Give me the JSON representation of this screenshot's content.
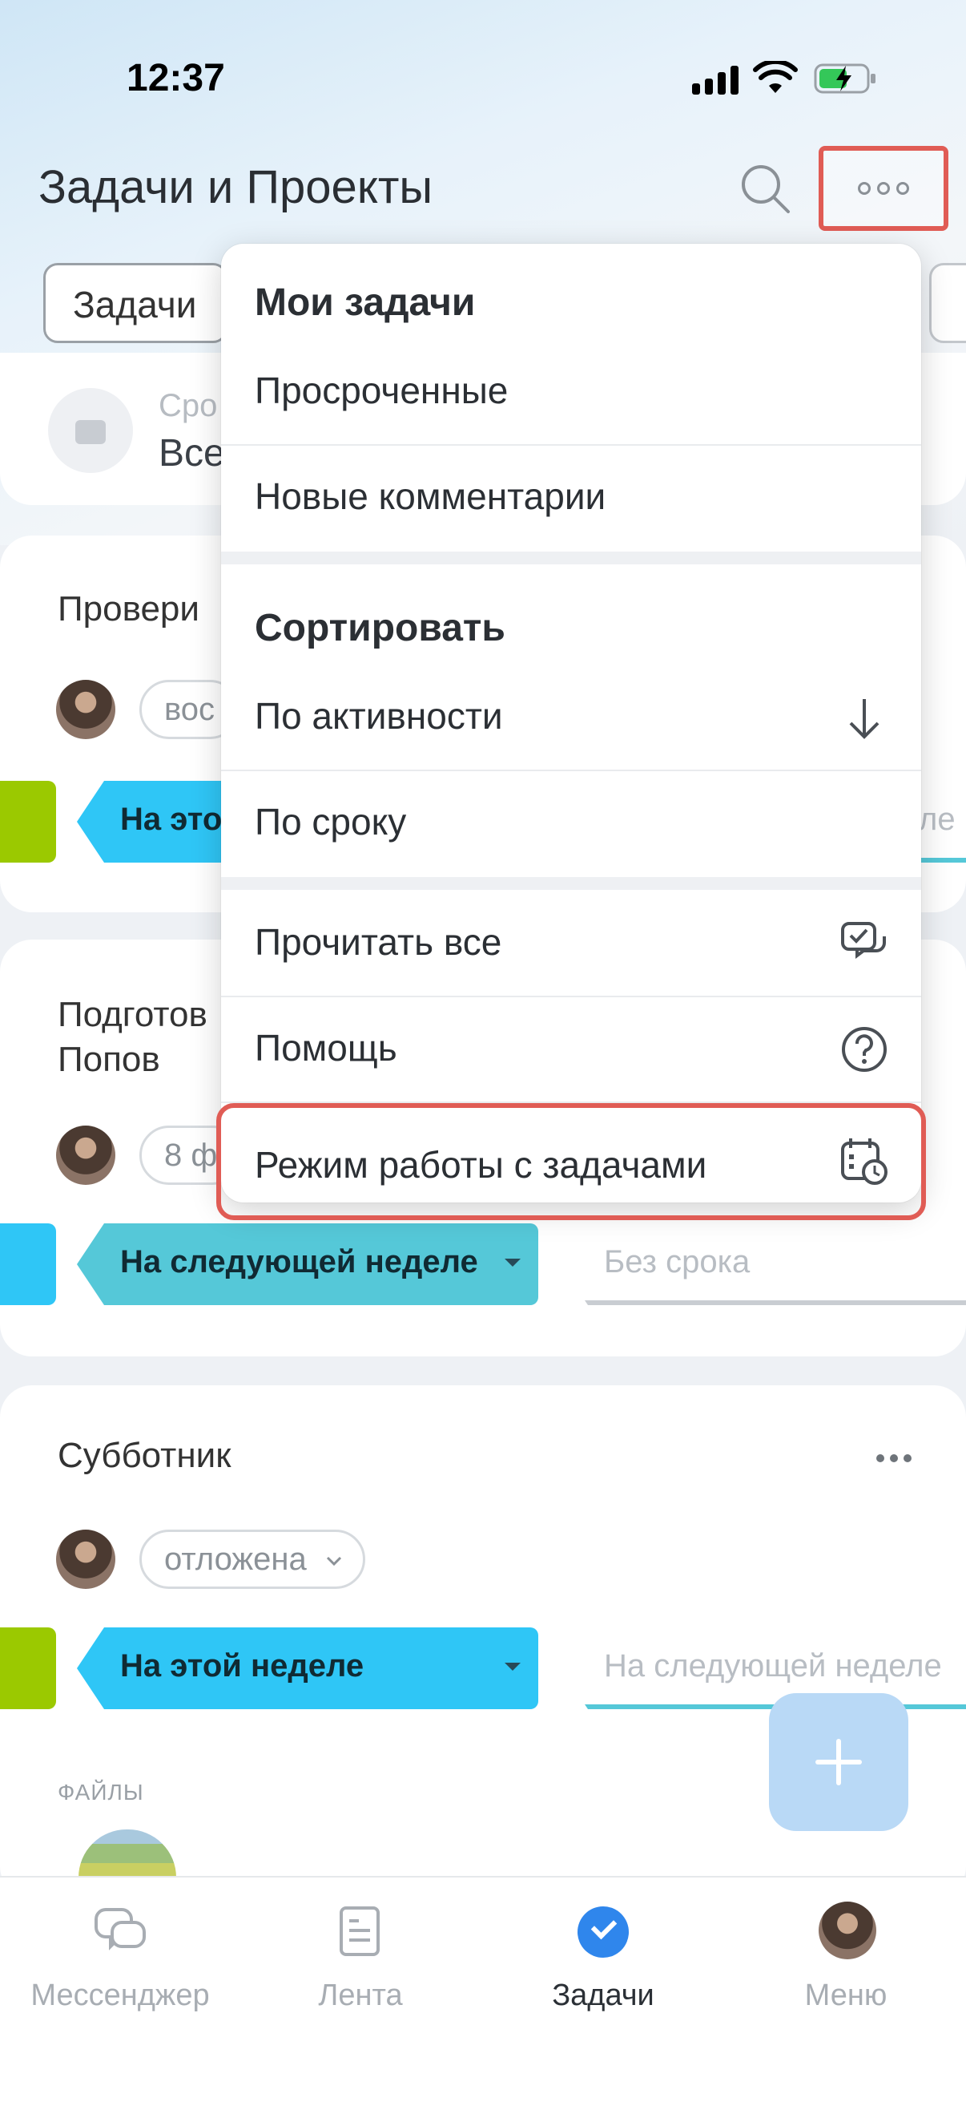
{
  "status_bar": {
    "time": "12:37"
  },
  "header": {
    "title": "Задачи и Проекты",
    "search_icon": "search-icon",
    "more_icon": "more-dots-icon"
  },
  "filters": {
    "tab_label": "Задачи",
    "counter_label": "Сро",
    "counter_value": "Все"
  },
  "tasks": [
    {
      "title": "Провери",
      "status": "вос",
      "stage": "На этой",
      "next_stage": "неле"
    },
    {
      "title_line1": "Подготов",
      "title_line2": "Попов",
      "status": "8 ф",
      "stage": "На следующей неделе",
      "next_stage": "Без срока"
    },
    {
      "title": "Субботник",
      "status": "отложена",
      "stage": "На этой неделе",
      "next_stage": "На следующей неделе",
      "files_label": "ФАЙЛЫ"
    }
  ],
  "menu": {
    "section1_title": "Мои задачи",
    "overdue": "Просроченные",
    "new_comments": "Новые комментарии",
    "section2_title": "Сортировать",
    "by_activity": "По активности",
    "by_deadline": "По сроку",
    "read_all": "Прочитать все",
    "help": "Помощь",
    "work_mode": "Режим работы с задачами"
  },
  "bottom_nav": {
    "messenger": "Мессенджер",
    "feed": "Лента",
    "tasks": "Задачи",
    "menu": "Меню"
  },
  "colors": {
    "accent_blue": "#2fc6f6",
    "accent_green": "#9bc900",
    "highlight_red": "#e05c55",
    "active_nav": "#2f86ec"
  }
}
